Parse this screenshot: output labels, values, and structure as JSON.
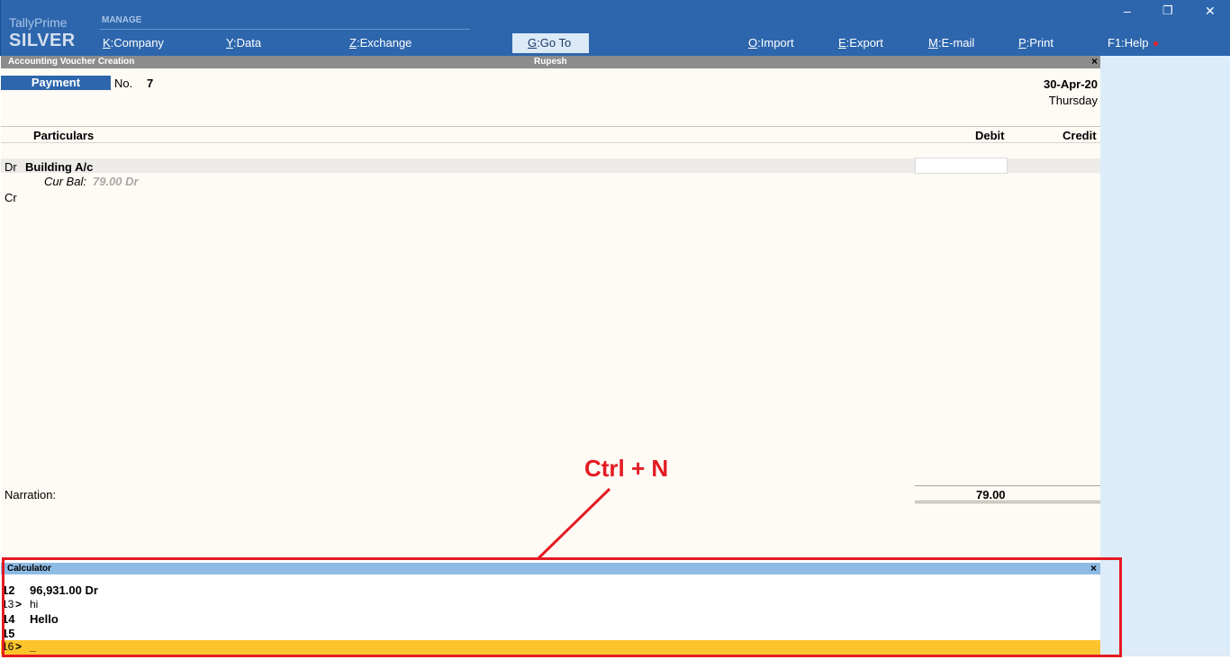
{
  "brand": {
    "name": "TallyPrime",
    "edition": "SILVER"
  },
  "top_menu": {
    "manage_label": "MANAGE",
    "company": {
      "key": "K",
      "label": "Company"
    },
    "data": {
      "key": "Y",
      "label": "Data"
    },
    "exchange": {
      "key": "Z",
      "label": "Exchange"
    },
    "goto": {
      "key": "G",
      "label": "Go To"
    },
    "import": {
      "key": "O",
      "label": "Import"
    },
    "export": {
      "key": "E",
      "label": "Export"
    },
    "email": {
      "key": "M",
      "label": "E-mail"
    },
    "print": {
      "key": "P",
      "label": "Print"
    },
    "help": {
      "key": "F1",
      "label": "Help"
    }
  },
  "window_controls": {
    "minimize": "–",
    "restore": "❐",
    "close": "✕"
  },
  "voucher": {
    "screen_title": "Accounting Voucher Creation",
    "company": "Rupesh",
    "close": "×",
    "type": "Payment",
    "no_label": "No.",
    "no_value": "7",
    "date": "30-Apr-20",
    "day": "Thursday",
    "columns": {
      "particulars": "Particulars",
      "debit": "Debit",
      "credit": "Credit"
    },
    "entries": {
      "dr_label": "Dr",
      "dr_ledger": "Building A/c",
      "cur_bal_label": "Cur Bal:",
      "cur_bal_value": "79.00 Dr",
      "cr_label": "Cr"
    },
    "narration_label": "Narration:",
    "total_debit": "79.00"
  },
  "calculator": {
    "title": "Calculator",
    "close": "×",
    "lines": [
      {
        "num": "12",
        "prompt": "",
        "text": "96,931.00 Dr"
      },
      {
        "num": "13",
        "prompt": ">",
        "text": "hi"
      },
      {
        "num": "14",
        "prompt": "",
        "text": "Hello"
      },
      {
        "num": "15",
        "prompt": "",
        "text": ""
      },
      {
        "num": "16",
        "prompt": ">",
        "text": "_"
      }
    ]
  },
  "annotation": {
    "label": "Ctrl + N",
    "color": "#e41b23"
  },
  "colors": {
    "topbar": "#2d66ad",
    "voucher_bg": "#fefaf4",
    "side_panel": "#ddecf9",
    "calc_header": "#8ebbe4",
    "calc_active_line": "#fec42d"
  }
}
